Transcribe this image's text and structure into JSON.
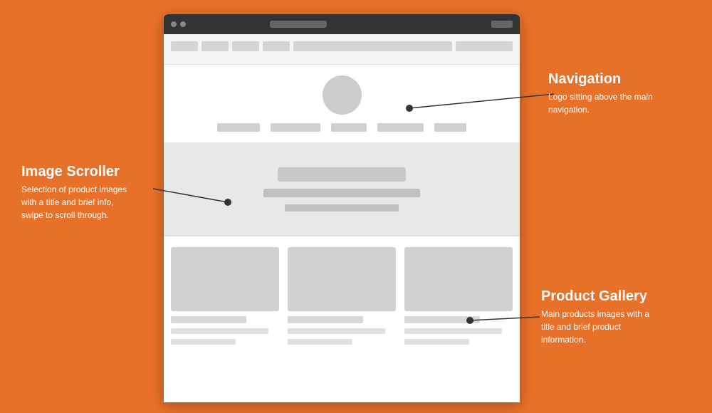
{
  "background_color": "#E8712A",
  "annotations": {
    "navigation": {
      "title": "Navigation",
      "description": "Logo sitting above the main navigation."
    },
    "image_scroller": {
      "title": "Image Scroller",
      "description": "Selection of product images with a title and brief info, swipe to scroll through."
    },
    "product_gallery": {
      "title": "Product Gallery",
      "description": "Main products images with a title and brief product information."
    }
  },
  "wireframe": {
    "nav_tabs": [
      "tab1",
      "tab2",
      "tab3",
      "tab4"
    ],
    "hero_bars": [
      "title",
      "subtitle",
      "text"
    ]
  }
}
